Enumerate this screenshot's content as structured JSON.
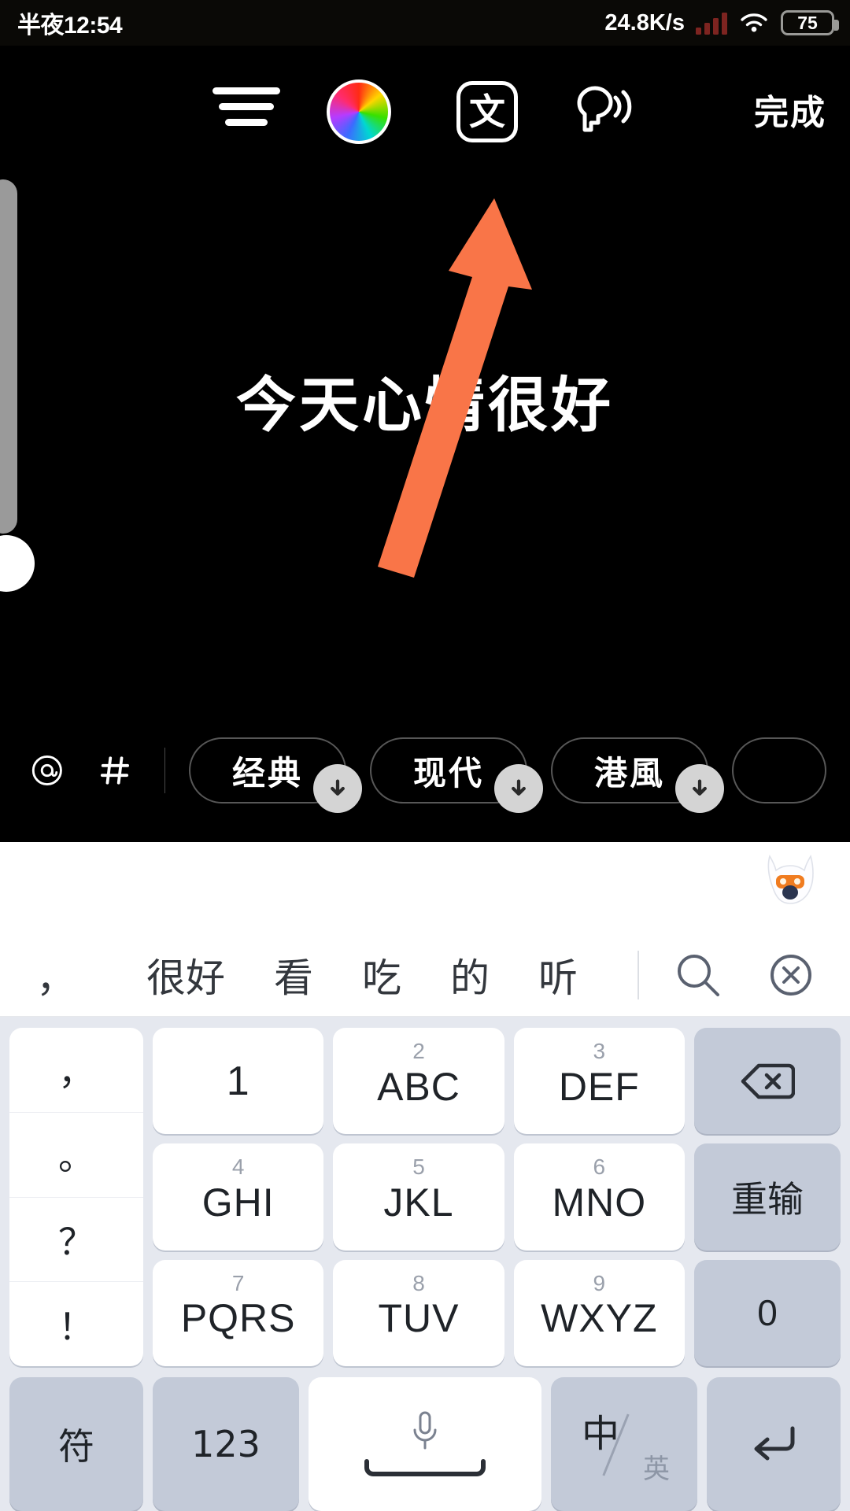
{
  "status_bar": {
    "time": "半夜12:54",
    "net_speed": "24.8K/s",
    "battery_level": "75",
    "signal_icon": "signal-bars-icon",
    "wifi_icon": "wifi-icon"
  },
  "editor": {
    "toolbar": {
      "align_icon": "text-align-icon",
      "color_icon": "color-wheel-icon",
      "font_label": "文",
      "tts_icon": "text-to-speech-icon",
      "done_label": "完成"
    },
    "canvas_text": "今天心情很好",
    "bottom_bar": {
      "mention_icon": "at-sign-icon",
      "hashtag_icon": "hashtag-icon",
      "style_chips": [
        {
          "label": "经典",
          "download_icon": "download-arrow-icon"
        },
        {
          "label": "现代",
          "download_icon": "download-arrow-icon"
        },
        {
          "label": "港風",
          "download_icon": "download-arrow-icon"
        },
        {
          "label": "",
          "download_icon": "download-arrow-icon"
        }
      ]
    },
    "annotation": {
      "arrow_icon": "pointer-arrow-icon",
      "arrow_color": "#f97548"
    }
  },
  "keyboard": {
    "mascot_icon": "sogou-mascot-icon",
    "candidates": [
      "，",
      "很好",
      "看",
      "吃",
      "的",
      "听"
    ],
    "candidate_tools": {
      "search_icon": "search-icon",
      "clear_icon": "clear-circle-icon"
    },
    "punctuation_keys": [
      "，",
      "。",
      "？",
      "！"
    ],
    "digit_keys": [
      {
        "sup": "",
        "main": "1"
      },
      {
        "sup": "2",
        "main": "ABC"
      },
      {
        "sup": "3",
        "main": "DEF"
      },
      {
        "sup": "4",
        "main": "GHI"
      },
      {
        "sup": "5",
        "main": "JKL"
      },
      {
        "sup": "6",
        "main": "MNO"
      },
      {
        "sup": "7",
        "main": "PQRS"
      },
      {
        "sup": "8",
        "main": "TUV"
      },
      {
        "sup": "9",
        "main": "WXYZ"
      }
    ],
    "function_keys": [
      {
        "label": "",
        "icon": "backspace-icon"
      },
      {
        "label": "重输",
        "icon": ""
      },
      {
        "label": "0",
        "icon": ""
      }
    ],
    "bottom_keys": {
      "symbol_label": "符",
      "numeric_label": "123",
      "space_icon": "microphone-icon",
      "lang_zh": "中",
      "lang_en": "英",
      "enter_icon": "enter-arrow-icon"
    }
  }
}
